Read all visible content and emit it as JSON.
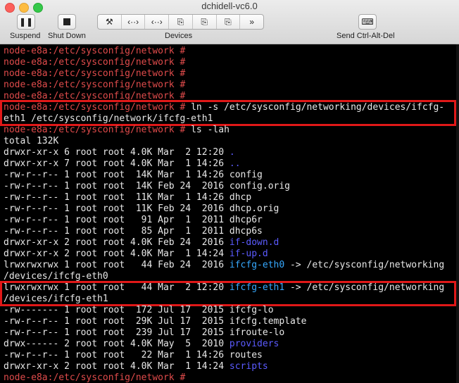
{
  "window": {
    "title": "dchidell-vc6.0"
  },
  "toolbar": {
    "suspend_label": "Suspend",
    "shutdown_label": "Shut Down",
    "devices_label": "Devices",
    "send_cad_label": "Send Ctrl-Alt-Del",
    "devices_glyphs": [
      "⚒",
      "‹··›",
      "‹··›",
      "⎘",
      "⎘",
      "⎘",
      "»"
    ]
  },
  "terminal": {
    "prompt": "node-e8a:/etc/sysconfig/network #",
    "cmd_ln": " ln -s /etc/sysconfig/networking/devices/ifcfg-",
    "cmd_ln_cont": "eth1 /etc/sysconfig/network/ifcfg-eth1",
    "cmd_ls": " ls -lah",
    "total": "total 132K",
    "rows": [
      {
        "meta": "drwxr-xr-x 6 root root 4.0K Mar  2 12:20 ",
        "name": ".",
        "cls": "blue",
        "rest": ""
      },
      {
        "meta": "drwxr-xr-x 7 root root 4.0K Mar  1 14:26 ",
        "name": "..",
        "cls": "blue",
        "rest": ""
      },
      {
        "meta": "-rw-r--r-- 1 root root  14K Mar  1 14:26 ",
        "name": "config",
        "cls": "",
        "rest": ""
      },
      {
        "meta": "-rw-r--r-- 1 root root  14K Feb 24  2016 ",
        "name": "config.orig",
        "cls": "",
        "rest": ""
      },
      {
        "meta": "-rw-r--r-- 1 root root  11K Mar  1 14:26 ",
        "name": "dhcp",
        "cls": "",
        "rest": ""
      },
      {
        "meta": "-rw-r--r-- 1 root root  11K Feb 24  2016 ",
        "name": "dhcp.orig",
        "cls": "",
        "rest": ""
      },
      {
        "meta": "-rw-r--r-- 1 root root   91 Apr  1  2011 ",
        "name": "dhcp6r",
        "cls": "",
        "rest": ""
      },
      {
        "meta": "-rw-r--r-- 1 root root   85 Apr  1  2011 ",
        "name": "dhcp6s",
        "cls": "",
        "rest": ""
      },
      {
        "meta": "drwxr-xr-x 2 root root 4.0K Feb 24  2016 ",
        "name": "if-down.d",
        "cls": "blue",
        "rest": ""
      },
      {
        "meta": "drwxr-xr-x 2 root root 4.0K Mar  1 14:24 ",
        "name": "if-up.d",
        "cls": "blue",
        "rest": ""
      },
      {
        "meta": "lrwxrwxrwx 1 root root   44 Feb 24  2016 ",
        "name": "ifcfg-eth0",
        "cls": "cyan",
        "rest": " -> /etc/sysconfig/networking"
      },
      {
        "meta": "/devices/ifcfg-eth0",
        "name": "",
        "cls": "",
        "rest": ""
      },
      {
        "meta": "lrwxrwxrwx 1 root root   44 Mar  2 12:20 ",
        "name": "ifcfg-eth1",
        "cls": "cyan",
        "rest": " -> /etc/sysconfig/networking"
      },
      {
        "meta": "/devices/ifcfg-eth1",
        "name": "",
        "cls": "",
        "rest": ""
      },
      {
        "meta": "-rw------- 1 root root  172 Jul 17  2015 ",
        "name": "ifcfg-lo",
        "cls": "",
        "rest": ""
      },
      {
        "meta": "-rw-r--r-- 1 root root  29K Jul 17  2015 ",
        "name": "ifcfg.template",
        "cls": "",
        "rest": ""
      },
      {
        "meta": "-rw-r--r-- 1 root root  239 Jul 17  2015 ",
        "name": "ifroute-lo",
        "cls": "",
        "rest": ""
      },
      {
        "meta": "drwx------ 2 root root 4.0K May  5  2010 ",
        "name": "providers",
        "cls": "blue",
        "rest": ""
      },
      {
        "meta": "-rw-r--r-- 1 root root   22 Mar  1 14:26 ",
        "name": "routes",
        "cls": "",
        "rest": ""
      },
      {
        "meta": "drwxr-xr-x 2 root root 4.0K Mar  1 14:24 ",
        "name": "scripts",
        "cls": "blue",
        "rest": ""
      }
    ]
  }
}
